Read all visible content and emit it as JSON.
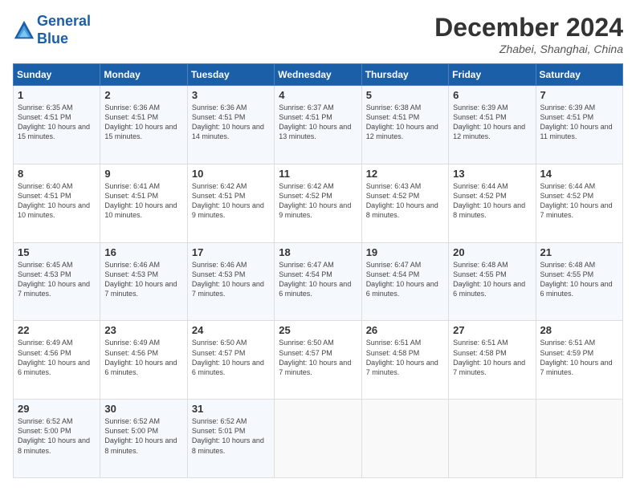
{
  "header": {
    "logo_line1": "General",
    "logo_line2": "Blue",
    "month_title": "December 2024",
    "location": "Zhabei, Shanghai, China"
  },
  "days_of_week": [
    "Sunday",
    "Monday",
    "Tuesday",
    "Wednesday",
    "Thursday",
    "Friday",
    "Saturday"
  ],
  "weeks": [
    [
      {
        "day": "1",
        "info": "Sunrise: 6:35 AM\nSunset: 4:51 PM\nDaylight: 10 hours and 15 minutes."
      },
      {
        "day": "2",
        "info": "Sunrise: 6:36 AM\nSunset: 4:51 PM\nDaylight: 10 hours and 15 minutes."
      },
      {
        "day": "3",
        "info": "Sunrise: 6:36 AM\nSunset: 4:51 PM\nDaylight: 10 hours and 14 minutes."
      },
      {
        "day": "4",
        "info": "Sunrise: 6:37 AM\nSunset: 4:51 PM\nDaylight: 10 hours and 13 minutes."
      },
      {
        "day": "5",
        "info": "Sunrise: 6:38 AM\nSunset: 4:51 PM\nDaylight: 10 hours and 12 minutes."
      },
      {
        "day": "6",
        "info": "Sunrise: 6:39 AM\nSunset: 4:51 PM\nDaylight: 10 hours and 12 minutes."
      },
      {
        "day": "7",
        "info": "Sunrise: 6:39 AM\nSunset: 4:51 PM\nDaylight: 10 hours and 11 minutes."
      }
    ],
    [
      {
        "day": "8",
        "info": "Sunrise: 6:40 AM\nSunset: 4:51 PM\nDaylight: 10 hours and 10 minutes."
      },
      {
        "day": "9",
        "info": "Sunrise: 6:41 AM\nSunset: 4:51 PM\nDaylight: 10 hours and 10 minutes."
      },
      {
        "day": "10",
        "info": "Sunrise: 6:42 AM\nSunset: 4:51 PM\nDaylight: 10 hours and 9 minutes."
      },
      {
        "day": "11",
        "info": "Sunrise: 6:42 AM\nSunset: 4:52 PM\nDaylight: 10 hours and 9 minutes."
      },
      {
        "day": "12",
        "info": "Sunrise: 6:43 AM\nSunset: 4:52 PM\nDaylight: 10 hours and 8 minutes."
      },
      {
        "day": "13",
        "info": "Sunrise: 6:44 AM\nSunset: 4:52 PM\nDaylight: 10 hours and 8 minutes."
      },
      {
        "day": "14",
        "info": "Sunrise: 6:44 AM\nSunset: 4:52 PM\nDaylight: 10 hours and 7 minutes."
      }
    ],
    [
      {
        "day": "15",
        "info": "Sunrise: 6:45 AM\nSunset: 4:53 PM\nDaylight: 10 hours and 7 minutes."
      },
      {
        "day": "16",
        "info": "Sunrise: 6:46 AM\nSunset: 4:53 PM\nDaylight: 10 hours and 7 minutes."
      },
      {
        "day": "17",
        "info": "Sunrise: 6:46 AM\nSunset: 4:53 PM\nDaylight: 10 hours and 7 minutes."
      },
      {
        "day": "18",
        "info": "Sunrise: 6:47 AM\nSunset: 4:54 PM\nDaylight: 10 hours and 6 minutes."
      },
      {
        "day": "19",
        "info": "Sunrise: 6:47 AM\nSunset: 4:54 PM\nDaylight: 10 hours and 6 minutes."
      },
      {
        "day": "20",
        "info": "Sunrise: 6:48 AM\nSunset: 4:55 PM\nDaylight: 10 hours and 6 minutes."
      },
      {
        "day": "21",
        "info": "Sunrise: 6:48 AM\nSunset: 4:55 PM\nDaylight: 10 hours and 6 minutes."
      }
    ],
    [
      {
        "day": "22",
        "info": "Sunrise: 6:49 AM\nSunset: 4:56 PM\nDaylight: 10 hours and 6 minutes."
      },
      {
        "day": "23",
        "info": "Sunrise: 6:49 AM\nSunset: 4:56 PM\nDaylight: 10 hours and 6 minutes."
      },
      {
        "day": "24",
        "info": "Sunrise: 6:50 AM\nSunset: 4:57 PM\nDaylight: 10 hours and 6 minutes."
      },
      {
        "day": "25",
        "info": "Sunrise: 6:50 AM\nSunset: 4:57 PM\nDaylight: 10 hours and 7 minutes."
      },
      {
        "day": "26",
        "info": "Sunrise: 6:51 AM\nSunset: 4:58 PM\nDaylight: 10 hours and 7 minutes."
      },
      {
        "day": "27",
        "info": "Sunrise: 6:51 AM\nSunset: 4:58 PM\nDaylight: 10 hours and 7 minutes."
      },
      {
        "day": "28",
        "info": "Sunrise: 6:51 AM\nSunset: 4:59 PM\nDaylight: 10 hours and 7 minutes."
      }
    ],
    [
      {
        "day": "29",
        "info": "Sunrise: 6:52 AM\nSunset: 5:00 PM\nDaylight: 10 hours and 8 minutes."
      },
      {
        "day": "30",
        "info": "Sunrise: 6:52 AM\nSunset: 5:00 PM\nDaylight: 10 hours and 8 minutes."
      },
      {
        "day": "31",
        "info": "Sunrise: 6:52 AM\nSunset: 5:01 PM\nDaylight: 10 hours and 8 minutes."
      },
      {
        "day": "",
        "info": ""
      },
      {
        "day": "",
        "info": ""
      },
      {
        "day": "",
        "info": ""
      },
      {
        "day": "",
        "info": ""
      }
    ]
  ]
}
